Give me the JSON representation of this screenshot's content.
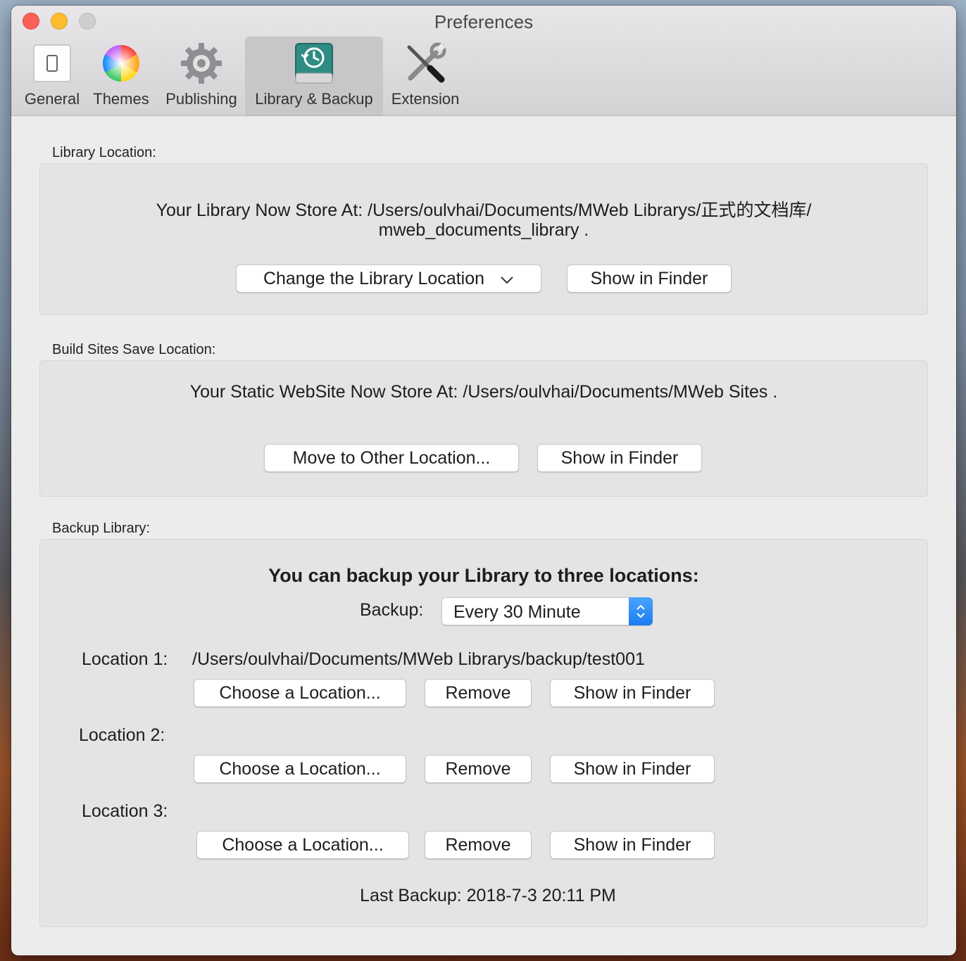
{
  "window": {
    "title": "Preferences"
  },
  "tabs": [
    {
      "label": "General",
      "icon": "switch-icon"
    },
    {
      "label": "Themes",
      "icon": "color-wheel-icon"
    },
    {
      "label": "Publishing",
      "icon": "gear-icon"
    },
    {
      "label": "Library & Backup",
      "icon": "time-machine-drive-icon",
      "active": true
    },
    {
      "label": "Extension",
      "icon": "tools-icon"
    }
  ],
  "library": {
    "section_label": "Library Location:",
    "path_line1": "Your Library Now Store At: /Users/oulvhai/Documents/MWeb Librarys/正式的文档库/",
    "path_line2": "mweb_documents_library .",
    "change_button": "Change the Library Location",
    "show_button": "Show in Finder"
  },
  "build_sites": {
    "section_label": "Build Sites Save Location:",
    "path_line": "Your Static WebSite Now Store At: /Users/oulvhai/Documents/MWeb Sites .",
    "move_button": "Move to Other Location...",
    "show_button": "Show in Finder"
  },
  "backup": {
    "section_label": "Backup Library:",
    "heading": "You can backup your Library to three locations:",
    "frequency_label": "Backup:",
    "frequency_value": "Every 30 Minute",
    "locations": [
      {
        "label": "Location 1:",
        "path": "/Users/oulvhai/Documents/MWeb Librarys/backup/test001",
        "choose": "Choose a Location...",
        "remove": "Remove",
        "show": "Show in Finder"
      },
      {
        "label": "Location 2:",
        "path": "",
        "choose": "Choose a Location...",
        "remove": "Remove",
        "show": "Show in Finder"
      },
      {
        "label": "Location 3:",
        "path": "",
        "choose": "Choose a Location...",
        "remove": "Remove",
        "show": "Show in Finder"
      }
    ],
    "last_backup": "Last Backup: 2018-7-3 20:11 PM"
  },
  "colors": {
    "close": "#fc5f57",
    "minimize": "#fdbc2e",
    "zoom": "#cfcdcf",
    "accent": "#1c7cf0"
  }
}
